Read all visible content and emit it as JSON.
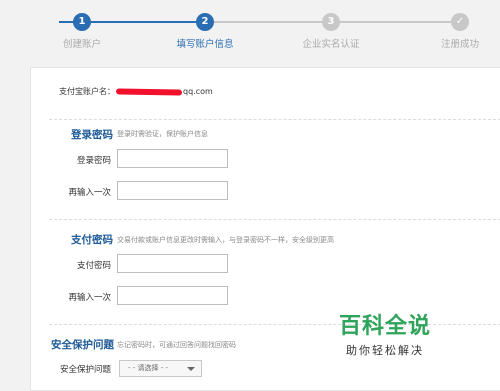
{
  "steps": [
    {
      "num": "1",
      "label": "创建账户"
    },
    {
      "num": "2",
      "label": "填写账户信息"
    },
    {
      "num": "3",
      "label": "企业实名认证"
    },
    {
      "num": "✓",
      "label": "注册成功"
    }
  ],
  "colors": {
    "active": "#2b6db2",
    "inactive": "#c8c8c8",
    "redaction": "#f1112c",
    "watermark": "#2ea35a"
  },
  "account": {
    "label": "支付宝账户名：",
    "value_suffix": "qq.com"
  },
  "login_password": {
    "title": "登录密码",
    "description": "登录时需验证，保护账户信息",
    "fields": [
      {
        "label": "登录密码",
        "value": ""
      },
      {
        "label": "再输入一次",
        "value": ""
      }
    ]
  },
  "payment_password": {
    "title": "支付密码",
    "description": "交易付款或账户信息更改时需输入，与登录密码不一样，安全级别更高",
    "fields": [
      {
        "label": "支付密码",
        "value": ""
      },
      {
        "label": "再输入一次",
        "value": ""
      }
    ]
  },
  "security_question": {
    "title": "安全保护问题",
    "description": "忘记密码时，可通过回答问题找回密码",
    "field_label": "安全保护问题",
    "select_value": "- - 请选择 - -"
  },
  "watermark": {
    "title": "百科全说",
    "subtitle": "助你轻松解决"
  }
}
